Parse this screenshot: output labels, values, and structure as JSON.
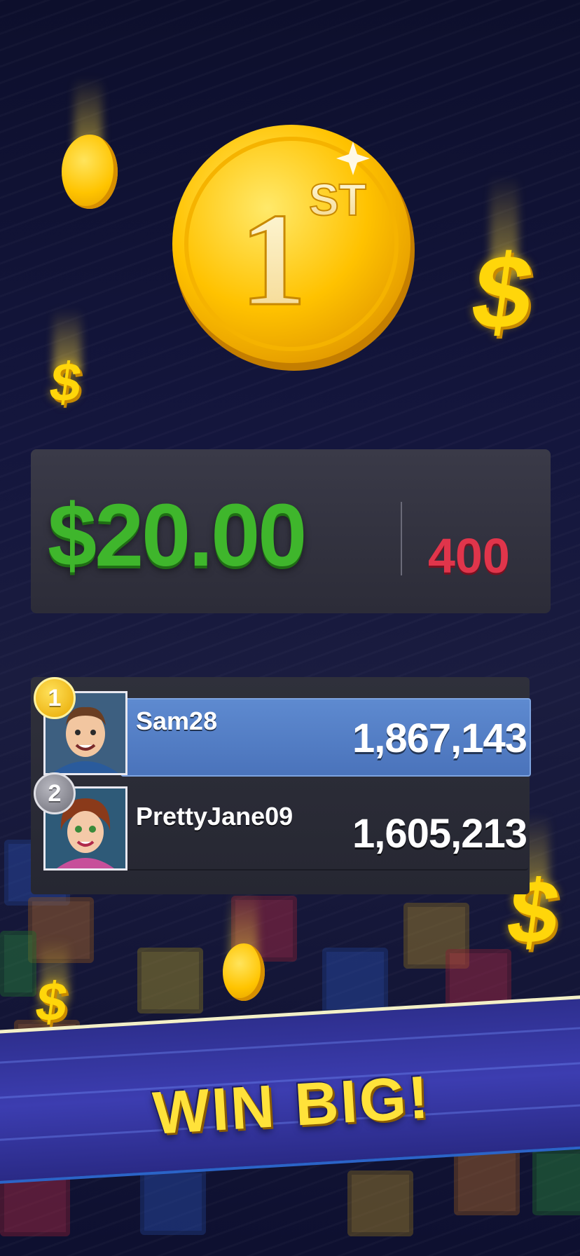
{
  "medal": {
    "rank_number": "1",
    "rank_suffix": "ST"
  },
  "prize": {
    "amount": "$20.00",
    "points": "400"
  },
  "leaderboard": [
    {
      "rank": "1",
      "name": "Sam28",
      "score": "1,867,143",
      "highlighted": true
    },
    {
      "rank": "2",
      "name": "PrettyJane09",
      "score": "1,605,213",
      "highlighted": false
    }
  ],
  "banner": {
    "text": "WIN BIG!"
  },
  "decorations": {
    "dollar_symbol": "$"
  },
  "colors": {
    "prize_green": "#3fb62c",
    "points_red": "#e0354b",
    "banner_yellow": "#ffe23a",
    "highlight_row_blue": "#5e8ad0",
    "coin_gold": "#ffc400"
  }
}
